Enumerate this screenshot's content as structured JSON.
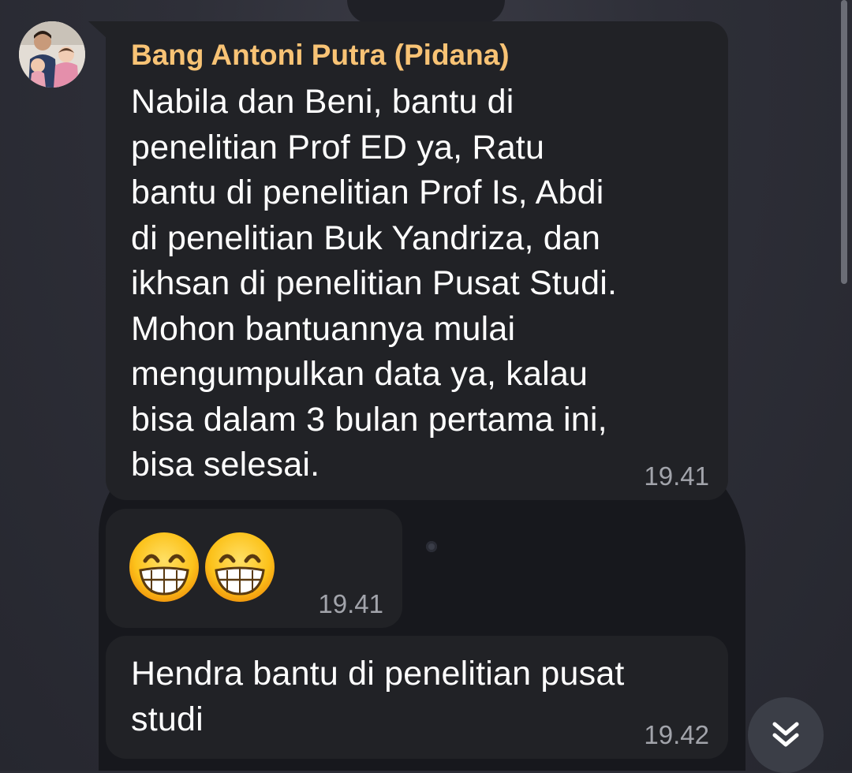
{
  "chat": {
    "messages": [
      {
        "sender": "Bang Antoni Putra (Pidana)",
        "text_lines": [
          "Nabila dan Beni, bantu di",
          "penelitian Prof ED ya, Ratu",
          "bantu di penelitian Prof Is, Abdi",
          "di penelitian Buk Yandriza, dan",
          "ikhsan di penelitian Pusat Studi.",
          "Mohon bantuannya mulai",
          "mengumpulkan data ya, kalau",
          "bisa dalam 3 bulan pertama ini,",
          "bisa selesai."
        ],
        "time": "19.41"
      },
      {
        "emojis": [
          "grinning-face-with-smiling-eyes",
          "grinning-face-with-smiling-eyes"
        ],
        "time": "19.41"
      },
      {
        "text_lines": [
          "Hendra bantu di penelitian pusat",
          "studi"
        ],
        "time": "19.42"
      }
    ]
  },
  "icons": {
    "avatar": "avatar-photo",
    "scroll_down": "double-chevron-down-icon"
  },
  "colors": {
    "bubble": "#212226",
    "sender_name": "#f8c375",
    "time": "#a2a4ab",
    "fab": "#3b3e47"
  }
}
